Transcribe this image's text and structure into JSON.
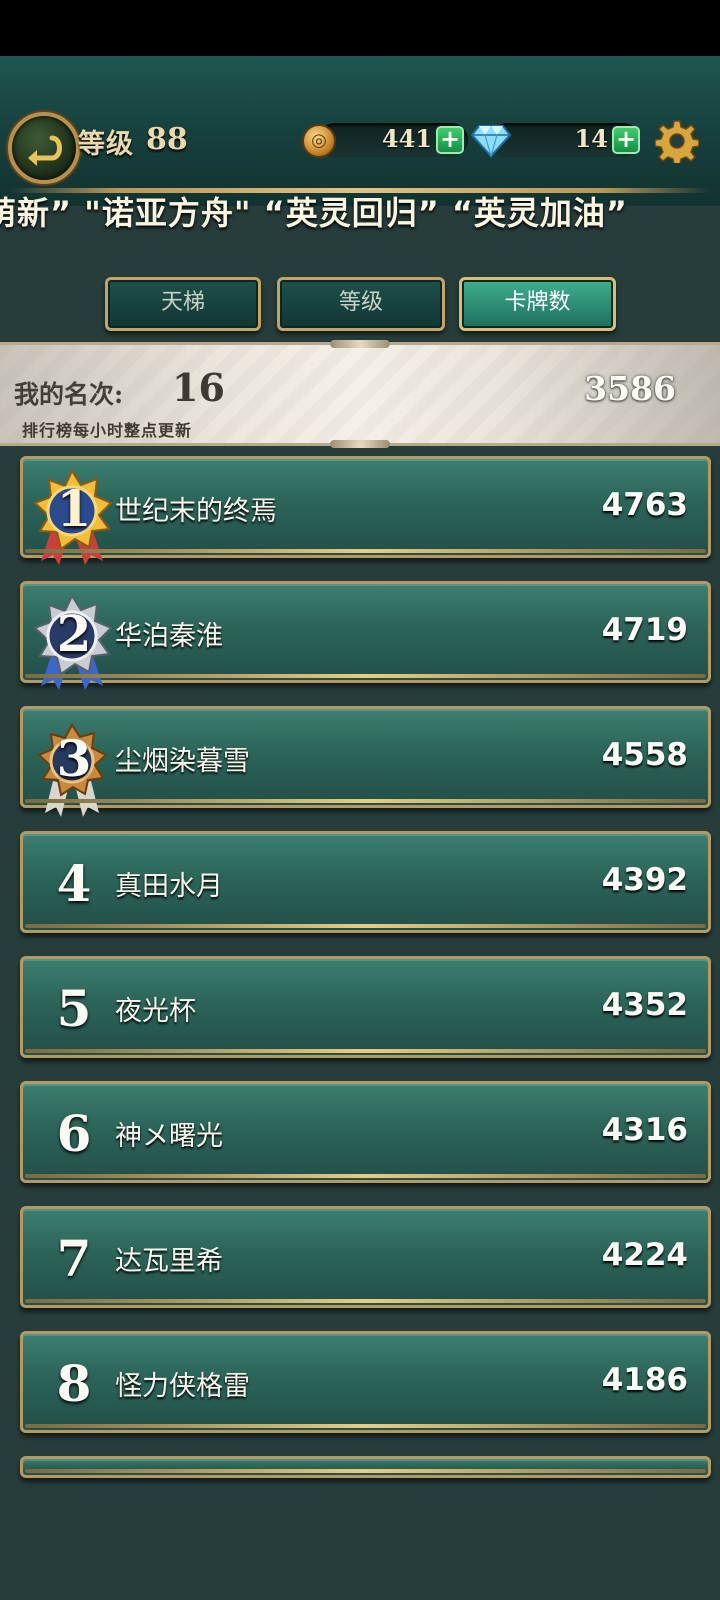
{
  "header": {
    "level_label": "等级",
    "level_value": "88",
    "gold": "441",
    "diamonds": "14",
    "ticker_text": "萌新”  \"诺亚方舟\"  “英灵回归”  “英灵加油”",
    "back_icon": "back-arrow-icon",
    "settings_icon": "gear-icon"
  },
  "tabs": [
    {
      "label": "天梯",
      "active": false
    },
    {
      "label": "等级",
      "active": false
    },
    {
      "label": "卡牌数",
      "active": true
    }
  ],
  "my_rank": {
    "label": "我的名次:",
    "value": "16",
    "score": "3586",
    "note": "排行榜每小时整点更新"
  },
  "leaderboard": [
    {
      "rank": "1",
      "name": "世纪末的终焉",
      "score": "4763",
      "medal": "gold"
    },
    {
      "rank": "2",
      "name": "华泊秦淮",
      "score": "4719",
      "medal": "silver"
    },
    {
      "rank": "3",
      "name": "尘烟染暮雪",
      "score": "4558",
      "medal": "bronze"
    },
    {
      "rank": "4",
      "name": "真田水月",
      "score": "4392"
    },
    {
      "rank": "5",
      "name": "夜光杯",
      "score": "4352"
    },
    {
      "rank": "6",
      "name": "神メ曙光",
      "score": "4316"
    },
    {
      "rank": "7",
      "name": "达瓦里希",
      "score": "4224"
    },
    {
      "rank": "8",
      "name": "怪力侠格雷",
      "score": "4186"
    }
  ],
  "colors": {
    "background": "#263d3b",
    "row": "#2c6458",
    "gold_trim": "#c3a464",
    "active_tab": "#3fb08e"
  }
}
